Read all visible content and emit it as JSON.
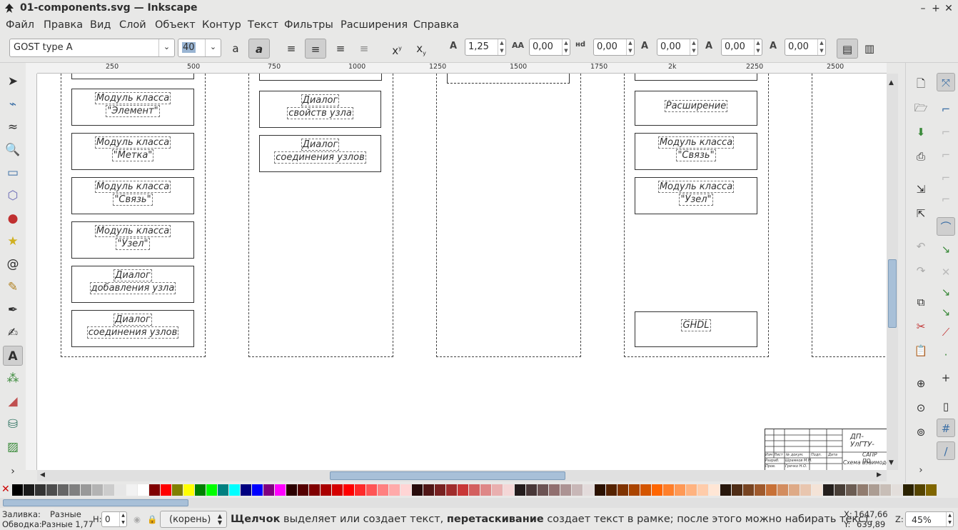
{
  "window": {
    "title": "01-components.svg — Inkscape"
  },
  "menu": [
    "Файл",
    "Правка",
    "Вид",
    "Слой",
    "Объект",
    "Контур",
    "Текст",
    "Фильтры",
    "Расширения",
    "Справка"
  ],
  "text_toolbar": {
    "font_family": "GOST type A",
    "font_size": "40",
    "line_spacing": "1,25",
    "letter_spacing": "0,00",
    "word_spacing": "0,00",
    "horizontal_kerning": "0,00",
    "vertical_shift": "0,00",
    "rotation": "0,00",
    "letter_spacing_icon_label": "AA",
    "word_spacing_icon_label": "нd",
    "superscript_label": "x",
    "subscript_label": "x"
  },
  "ruler": {
    "h_labels": [
      "250",
      "500",
      "750",
      "1000",
      "1250",
      "1500",
      "1750",
      "2k",
      "2250",
      "2500"
    ]
  },
  "canvas": {
    "columns": [
      {
        "boxes": [
          [
            "Модуль класса",
            "\"Элемент\""
          ],
          [
            "Модуль класса",
            "\"Метка\""
          ],
          [
            "Модуль класса",
            "\"Связь\""
          ],
          [
            "Модуль класса",
            "\"Узел\""
          ],
          [
            "Диалог",
            "добавления узла"
          ],
          [
            "Диалог",
            "соединения узлов"
          ]
        ]
      },
      {
        "boxes": [
          [
            "Диалог",
            "свойств узла"
          ],
          [
            "Диалог",
            "соединения узлов"
          ]
        ]
      },
      {
        "boxes": []
      },
      {
        "boxes": [
          [
            "Расширение"
          ],
          [
            "Модуль класса",
            "\"Связь\""
          ],
          [
            "Модуль класса",
            "\"Узел\""
          ],
          [
            "GHDL"
          ]
        ]
      }
    ],
    "title_block": {
      "doc_code": "ДП-УлГТУ-",
      "org": "САПР ПО",
      "caption": "Схема взаимодейс",
      "rows": [
        "Изм",
        "Лист",
        "№ докум.",
        "Подп.",
        "Дата",
        "Разраб.",
        "Шрамков М.М.",
        "Пров.",
        "Гречко Н.О."
      ]
    }
  },
  "status": {
    "fill_label": "Заливка:",
    "fill_value": "Разные",
    "stroke_label": "Обводка:",
    "stroke_value": "Разные 1,77",
    "h_label": "H:",
    "h_value": "0",
    "layer": "(корень)",
    "message_bold1": "Щелчок",
    "message_part1": " выделяет или создает текст, ",
    "message_bold2": "перетаскивание",
    "message_part2": " создает текст в рамке; после этого можно набирать текст.",
    "x_label": "X:",
    "x_value": "1647,66",
    "y_label": "Y:",
    "y_value": "639,89",
    "zoom_label": "Z:",
    "zoom_value": "45%"
  },
  "colors": {
    "accent": "#a8c0d8",
    "canvas_bg": "#ffffff",
    "ui_bg": "#e8e8e7"
  }
}
